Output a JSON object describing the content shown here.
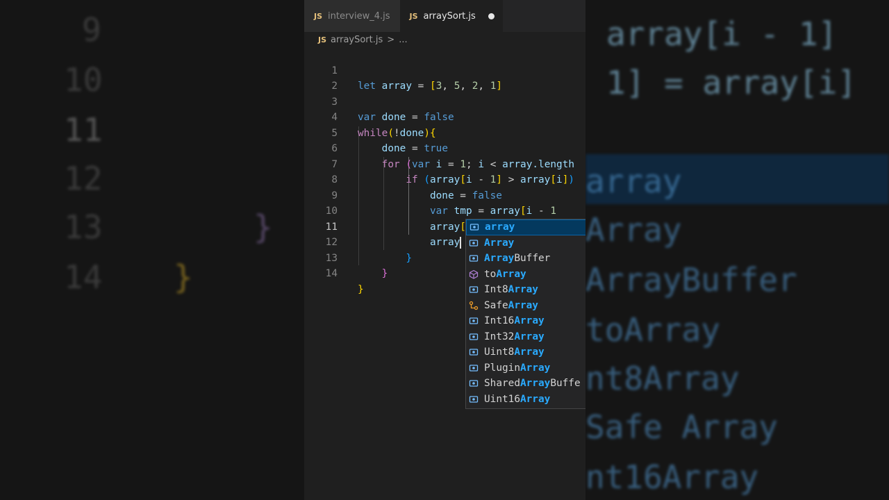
{
  "background": {
    "left_line_numbers": [
      "9",
      "10",
      "11",
      "12",
      "13",
      "14"
    ],
    "left_braces": [
      "}",
      "}"
    ],
    "right_code": [
      "array[i - 1]",
      "1] = array[i]"
    ],
    "right_suggestions": [
      "array",
      "Array",
      "ArrayBuffer",
      "toArray",
      "nt8Array",
      "Safe Array",
      "nt16Array"
    ]
  },
  "tabs": [
    {
      "icon": "JS",
      "label": "interview_4.js",
      "active": false
    },
    {
      "icon": "JS",
      "label": "arraySort.js",
      "active": true,
      "modified": true
    }
  ],
  "breadcrumb": {
    "icon": "JS",
    "file": "arraySort.js",
    "separator": ">",
    "more": "..."
  },
  "line_numbers": [
    "1",
    "2",
    "3",
    "4",
    "5",
    "6",
    "7",
    "8",
    "9",
    "10",
    "11",
    "12",
    "13",
    "14"
  ],
  "current_line": "11",
  "code": {
    "l1": {
      "kw": "let",
      "name": "array",
      "eq": "=",
      "open": "[",
      "n1": "3",
      "c1": ",",
      "n2": "5",
      "c2": ",",
      "n3": "2",
      "c3": ",",
      "n4": "1",
      "close": "]"
    },
    "l3": {
      "kw": "var",
      "name": "done",
      "eq": "=",
      "val": "false"
    },
    "l4": {
      "kw": "while",
      "open": "(",
      "bang": "!",
      "name": "done",
      "close": ")",
      "brace": "{"
    },
    "l5": {
      "name": "done",
      "eq": "=",
      "val": "true"
    },
    "l6": {
      "kw": "for",
      "open": "(",
      "kw2": "var",
      "i": "i",
      "eq": "=",
      "one": "1",
      "semi": ";",
      "i2": "i",
      "lt": "<",
      "arr": "array",
      "prop": ".length"
    },
    "l7": {
      "kw": "if",
      "open": "(",
      "arr": "array",
      "ob": "[",
      "i": "i",
      "minus": "-",
      "one": "1",
      "cb": "]",
      "gt": ">",
      "arr2": "array",
      "ob2": "[",
      "i2": "i",
      "cb2": "]",
      "close": ")"
    },
    "l8": {
      "name": "done",
      "eq": "=",
      "val": "false"
    },
    "l9": {
      "kw": "var",
      "name": "tmp",
      "eq": "=",
      "arr": "array",
      "ob": "[",
      "i": "i",
      "minus": "-",
      "one": "1"
    },
    "l10": {
      "arr": "array",
      "ob": "[",
      "i": "i",
      "minus": "-",
      "one": "1",
      "cb": "]",
      "eq": "=",
      "arr2": "array",
      "ob2": "[",
      "i2": "i",
      "cb2": "]"
    },
    "l11": {
      "typed": "array"
    },
    "l12": {
      "brace": "}"
    },
    "l13": {
      "brace": "}"
    },
    "l14": {
      "brace": "}"
    }
  },
  "suggestions": [
    {
      "pre": "",
      "match": "array",
      "post": "",
      "icon": "variable-icon",
      "selected": true
    },
    {
      "pre": "",
      "match": "Array",
      "post": "",
      "icon": "variable-icon"
    },
    {
      "pre": "",
      "match": "Array",
      "post": "Buffer",
      "icon": "variable-icon"
    },
    {
      "pre": "to",
      "match": "Array",
      "post": "",
      "icon": "method-icon"
    },
    {
      "pre": "Int8",
      "match": "Array",
      "post": "",
      "icon": "variable-icon"
    },
    {
      "pre": "Safe",
      "match": "Array",
      "post": "",
      "icon": "reference-icon"
    },
    {
      "pre": "Int16",
      "match": "Array",
      "post": "",
      "icon": "variable-icon"
    },
    {
      "pre": "Int32",
      "match": "Array",
      "post": "",
      "icon": "variable-icon"
    },
    {
      "pre": "Uint8",
      "match": "Array",
      "post": "",
      "icon": "variable-icon"
    },
    {
      "pre": "Plugin",
      "match": "Array",
      "post": "",
      "icon": "variable-icon"
    },
    {
      "pre": "Shared",
      "match": "Array",
      "post": "Buffe",
      "icon": "variable-icon"
    },
    {
      "pre": "Uint16",
      "match": "Array",
      "post": "",
      "icon": "variable-icon"
    }
  ],
  "colors": {
    "keyword": "#569cd6",
    "variable": "#9cdcfe",
    "number": "#b5cea8",
    "match": "#2aaaff",
    "selection": "#04395e"
  }
}
